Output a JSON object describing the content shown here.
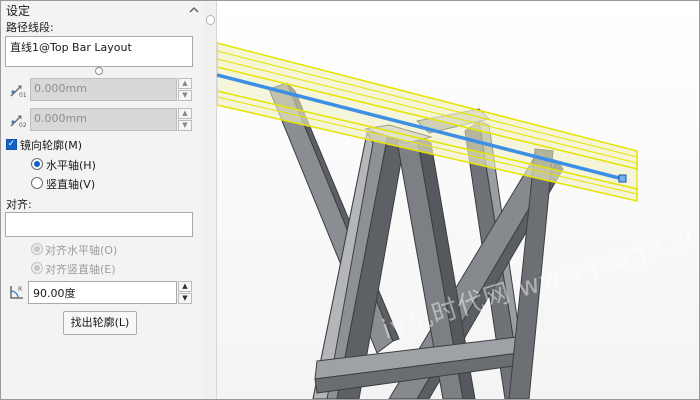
{
  "panel": {
    "title": "设定",
    "collapse_icon": "chevron-up-icon",
    "path_segment_label": "路径线段:",
    "path_segment_value": "直线1@Top Bar Layout",
    "offset1_value": "0.000mm",
    "offset2_value": "0.000mm",
    "mirror_profile_label": "镜向轮廓(M)",
    "mirror_profile_checked": true,
    "horizontal_axis_label": "水平轴(H)",
    "vertical_axis_label": "竖直轴(V)",
    "mirror_axis_selected": "horizontal",
    "align_label": "对齐:",
    "align_value": "",
    "align_horizontal_label": "对齐水平轴(O)",
    "align_vertical_label": "对齐竖直轴(E)",
    "rotation_value": "90.00度",
    "find_profile_button": "找出轮廓(L)"
  },
  "viewport": {
    "description_colors": {
      "beam_outline": "#e6e600",
      "beam_fill": "#f1f0c6",
      "path_line": "#3d8fe6",
      "steel": "#7f8287"
    },
    "watermark": "iv机时代网 www.jxage.com"
  }
}
